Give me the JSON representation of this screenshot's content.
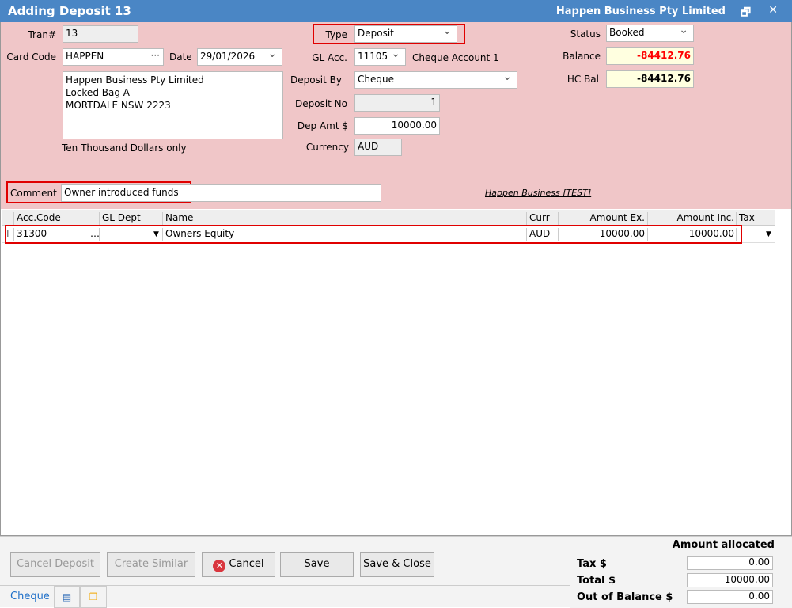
{
  "window": {
    "title": "Adding Deposit 13",
    "company": "Happen Business Pty Limited",
    "restore_icon": "restore-icon",
    "close_icon": "close-icon"
  },
  "form": {
    "tran_label": "Tran#",
    "tran": "13",
    "card_code_label": "Card Code",
    "card_code": "HAPPEN",
    "date_label": "Date",
    "date": "29/01/2026",
    "address": [
      "Happen Business Pty Limited",
      "Locked Bag A",
      "MORTDALE NSW 2223"
    ],
    "amount_words": "Ten Thousand Dollars only",
    "type_label": "Type",
    "type": "Deposit",
    "gl_acc_label": "GL Acc.",
    "gl_acc": "11105",
    "gl_acc_name": "Cheque Account 1",
    "deposit_by_label": "Deposit By",
    "deposit_by": "Cheque",
    "deposit_no_label": "Deposit No",
    "deposit_no": "1",
    "dep_amt_label": "Dep Amt $",
    "dep_amt": "10000.00",
    "currency_label": "Currency",
    "currency": "AUD",
    "status_label": "Status",
    "status": "Booked",
    "balance_label": "Balance",
    "balance": "-84412.76",
    "hc_bal_label": "HC Bal",
    "hc_bal": "-84412.76",
    "comment_label": "Comment",
    "comment": "Owner introduced funds",
    "company_link": "Happen Business [TEST]"
  },
  "colors": {
    "balance_negative": "#ff0000",
    "highlight": "#e00000",
    "title_bar": "#4a86c5",
    "form_bg": "#f0c6c8"
  },
  "grid": {
    "columns": [
      "Acc.Code",
      "GL Dept",
      "Name",
      "Curr",
      "Amount Ex.",
      "Amount Inc.",
      "Tax"
    ],
    "rows": [
      {
        "acc_code": "31300",
        "gl_dept": "",
        "name": "Owners Equity",
        "curr": "AUD",
        "amount_ex": "10000.00",
        "amount_inc": "10000.00",
        "tax": ""
      }
    ]
  },
  "buttons": {
    "cancel_deposit": "Cancel Deposit",
    "create_similar": "Create Similar",
    "cancel": "Cancel",
    "save": "Save",
    "save_close": "Save & Close"
  },
  "tabs": {
    "cheque": "Cheque"
  },
  "summary": {
    "header": "Amount allocated",
    "tax_label": "Tax $",
    "tax": "0.00",
    "total_label": "Total $",
    "total": "10000.00",
    "oob_label": "Out of Balance $",
    "oob": "0.00"
  }
}
